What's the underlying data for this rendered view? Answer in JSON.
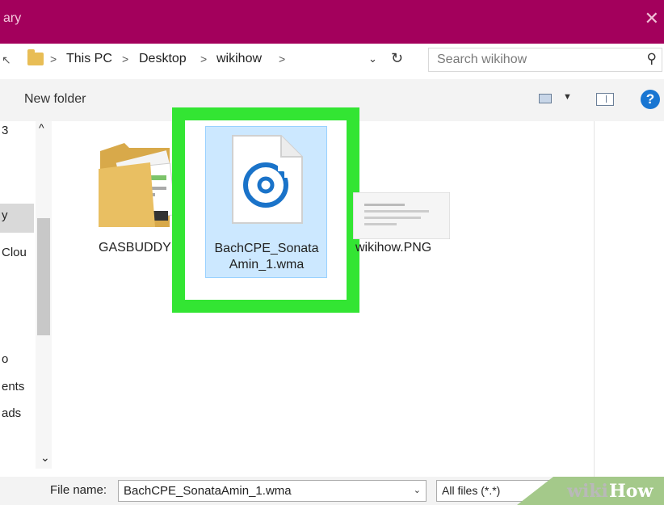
{
  "window": {
    "title_fragment": "ary",
    "close_glyph": "✕"
  },
  "address_bar": {
    "crumbs": [
      "This PC",
      "Desktop",
      "wikihow"
    ],
    "separator": ">",
    "search_placeholder": "Search wikihow"
  },
  "toolbar": {
    "new_folder_label": "New folder",
    "help_glyph": "?"
  },
  "nav_pane": {
    "items": [
      "3",
      "y",
      "Clou",
      "o",
      "ents",
      "ads"
    ]
  },
  "files": [
    {
      "label": "GASBUDDY",
      "kind": "folder"
    },
    {
      "label": "BachCPE_Sonata Amin_1.wma",
      "kind": "audio",
      "selected": true
    },
    {
      "label": "wikihow.PNG",
      "kind": "image"
    }
  ],
  "file_name": {
    "label": "File name:",
    "value": "BachCPE_SonataAmin_1.wma"
  },
  "file_filter": {
    "value": "All files (*.*)"
  },
  "watermark": {
    "part1": "wiki",
    "part2": "How"
  },
  "colors": {
    "titlebar": "#a3005c",
    "highlight": "#33e533",
    "selection": "#cce8ff",
    "audio_icon": "#1a73c9",
    "watermark_green": "#a4c98a"
  },
  "icons": [
    "back-arrow-icon",
    "folder-icon",
    "refresh-icon",
    "search-icon",
    "view-icon",
    "preview-pane-icon",
    "help-icon",
    "audio-file-icon",
    "close-icon"
  ]
}
